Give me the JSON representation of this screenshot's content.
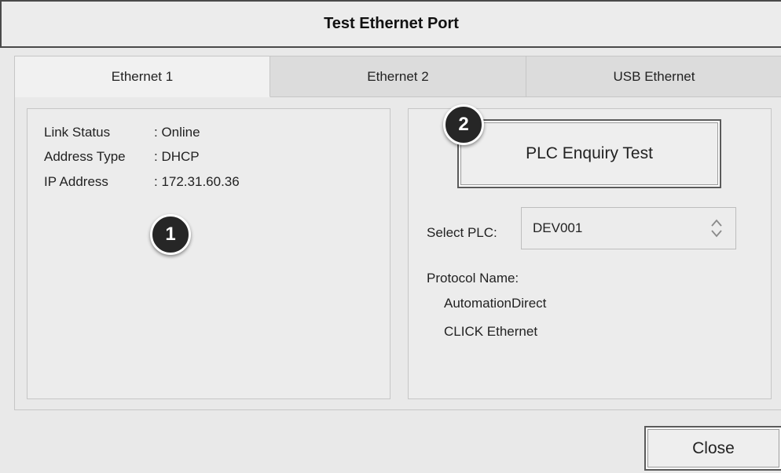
{
  "window": {
    "title": "Test Ethernet Port"
  },
  "tabs": [
    {
      "label": "Ethernet 1",
      "active": true
    },
    {
      "label": "Ethernet 2",
      "active": false
    },
    {
      "label": "USB Ethernet",
      "active": false
    }
  ],
  "info": {
    "rows": [
      {
        "label": "Link Status",
        "value": ": Online"
      },
      {
        "label": "Address Type",
        "value": ": DHCP"
      },
      {
        "label": "IP Address",
        "value": ": 172.31.60.36"
      }
    ],
    "callout": "1"
  },
  "plc": {
    "callout": "2",
    "enquiry_button": "PLC Enquiry Test",
    "select_label": "Select PLC:",
    "select_value": "DEV001",
    "protocol_label": "Protocol Name:",
    "protocol_lines": [
      "AutomationDirect",
      "CLICK Ethernet"
    ]
  },
  "footer": {
    "close_label": "Close"
  },
  "icons": {
    "select_arrows": "up-down-chevron-icon"
  }
}
